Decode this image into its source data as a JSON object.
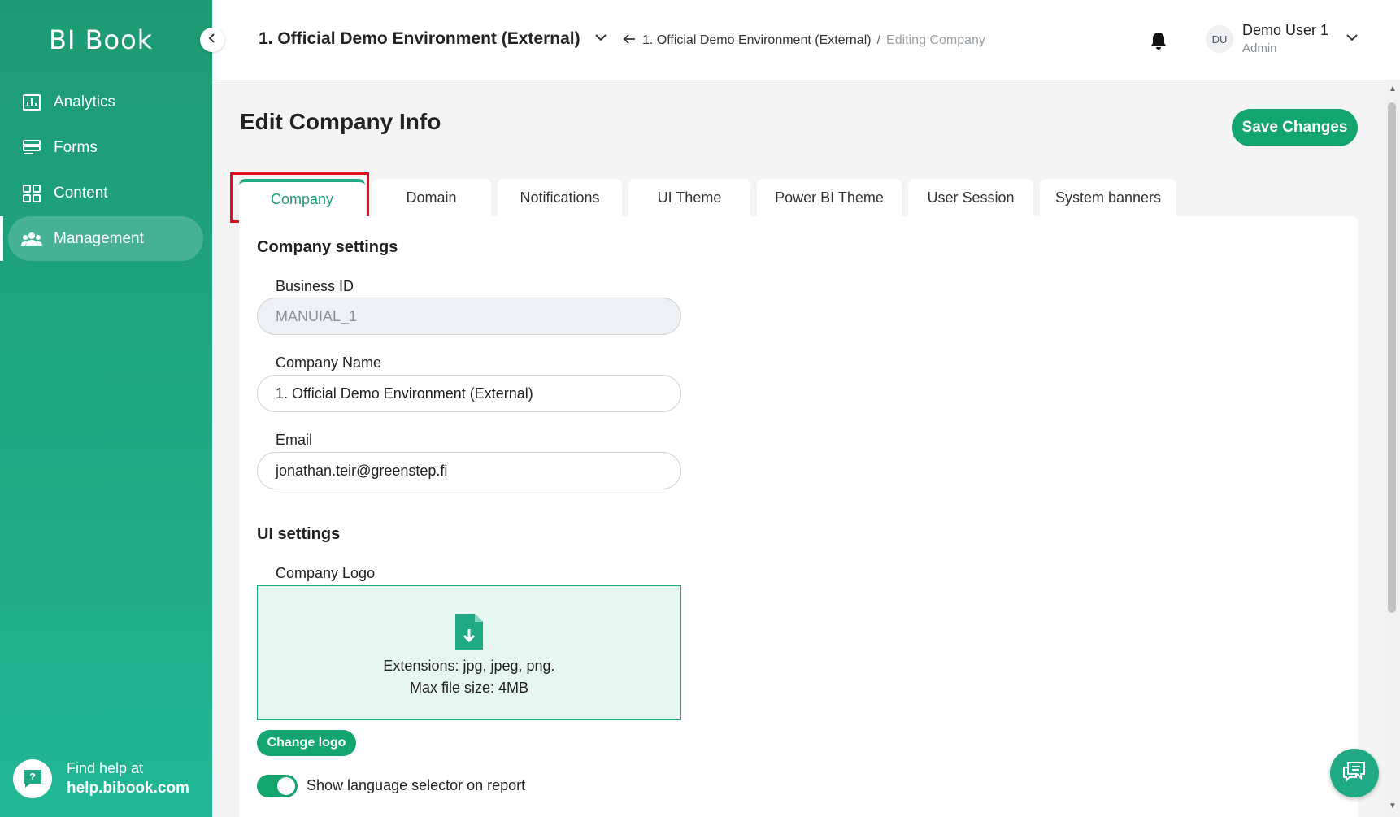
{
  "sidebar": {
    "logo": "BI Book",
    "items": [
      {
        "label": "Analytics",
        "icon": "bar-chart-icon"
      },
      {
        "label": "Forms",
        "icon": "list-icon"
      },
      {
        "label": "Content",
        "icon": "grid-icon"
      },
      {
        "label": "Management",
        "icon": "people-icon",
        "active": true
      }
    ],
    "help": {
      "line1": "Find help at",
      "line2": "help.bibook.com"
    }
  },
  "header": {
    "environment": "1. Official Demo Environment (External)",
    "breadcrumb": {
      "parent": "1. Official Demo Environment (External)",
      "separator": "/",
      "current": "Editing Company"
    },
    "user": {
      "initials": "DU",
      "name": "Demo User 1",
      "role": "Admin"
    }
  },
  "page": {
    "title": "Edit Company Info",
    "save_label": "Save Changes",
    "tabs": [
      "Company",
      "Domain",
      "Notifications",
      "UI Theme",
      "Power BI Theme",
      "User Session",
      "System banners"
    ],
    "active_tab": "Company"
  },
  "company_settings": {
    "title": "Company settings",
    "business_id": {
      "label": "Business ID",
      "value": "MANUIAL_1"
    },
    "company_name": {
      "label": "Company Name",
      "value": "1. Official Demo Environment (External)"
    },
    "email": {
      "label": "Email",
      "value": "jonathan.teir@greenstep.fi"
    }
  },
  "ui_settings": {
    "title": "UI settings",
    "logo_label": "Company Logo",
    "extensions": "Extensions: jpg, jpeg, png.",
    "max_size": "Max file size: 4MB",
    "change_logo": "Change logo",
    "language_toggle": {
      "label": "Show language selector on report",
      "on": true
    }
  },
  "colors": {
    "brand": "#1faa85",
    "button": "#12a56e",
    "highlight": "#e3101c"
  }
}
